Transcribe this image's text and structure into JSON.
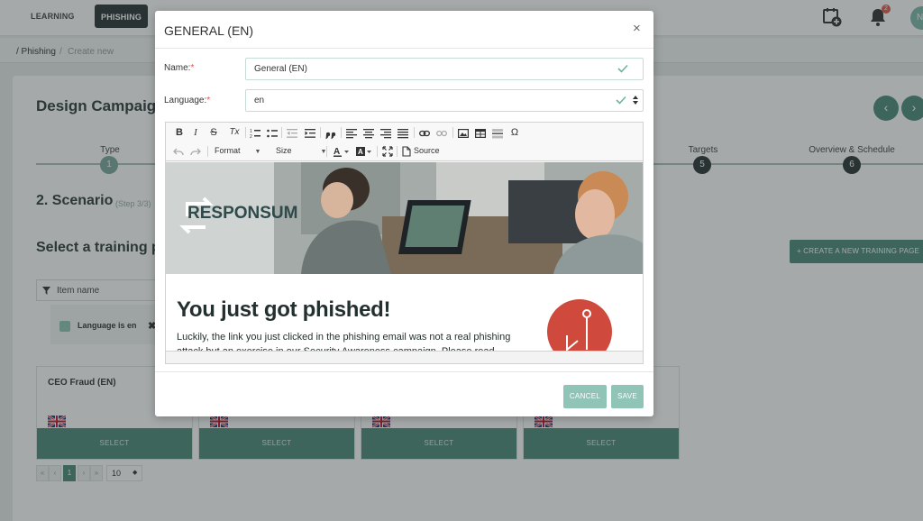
{
  "topnav": {
    "learning": "LEARNING",
    "phishing": "PHISHING",
    "notif_count": "2",
    "avatar_initial": "N"
  },
  "breadcrumb": {
    "item1": "/ Phishing",
    "sep": "/",
    "item2": "Create new"
  },
  "page": {
    "title": "Design Campaign",
    "steps": [
      {
        "label": "Type",
        "num": "1"
      },
      {
        "label": "Targets",
        "num": "5"
      },
      {
        "label": "Overview & Schedule",
        "num": "6"
      }
    ],
    "scenario_title": "2. Scenario",
    "scenario_sub": "(Step 3/3)",
    "select_title": "Select a training p",
    "create_button": "+ CREATE A NEW TRAINING PAGE",
    "filter_label": "Item name",
    "chip_label": "Language is en",
    "chip_x": "✖",
    "cards": [
      {
        "title": "CEO Fraud (EN)",
        "select": "SELECT"
      },
      {
        "title": "",
        "select": "SELECT"
      },
      {
        "title": "",
        "select": "SELECT"
      },
      {
        "title": "",
        "select": "SELECT"
      }
    ],
    "pager": {
      "first": "«",
      "prev": "‹",
      "page": "1",
      "next": "›",
      "last": "»",
      "per_page": "10"
    }
  },
  "modal": {
    "title": "GENERAL (EN)",
    "close": "×",
    "name_label": "Name:",
    "name_value": "General (EN)",
    "language_label": "Language:",
    "language_value": "en",
    "required_mark": "*",
    "toolbar": {
      "bold": "B",
      "italic": "I",
      "strike": "S",
      "clear": "Tx",
      "format": "Format",
      "size": "Size",
      "source": "Source"
    },
    "content": {
      "brand": "RESPONSUM",
      "heading": "You just got phished!",
      "paragraph": "Luckily, the link you just clicked in the phishing email was not a real phishing attack but an exercise in our Security Awareness campaign. Please read this"
    },
    "cancel": "CANCEL",
    "save": "SAVE"
  },
  "colors": {
    "accent": "#4d8a7b",
    "accent_light": "#8fc4b6",
    "danger": "#cf4a3d",
    "dark": "#2b3535"
  }
}
